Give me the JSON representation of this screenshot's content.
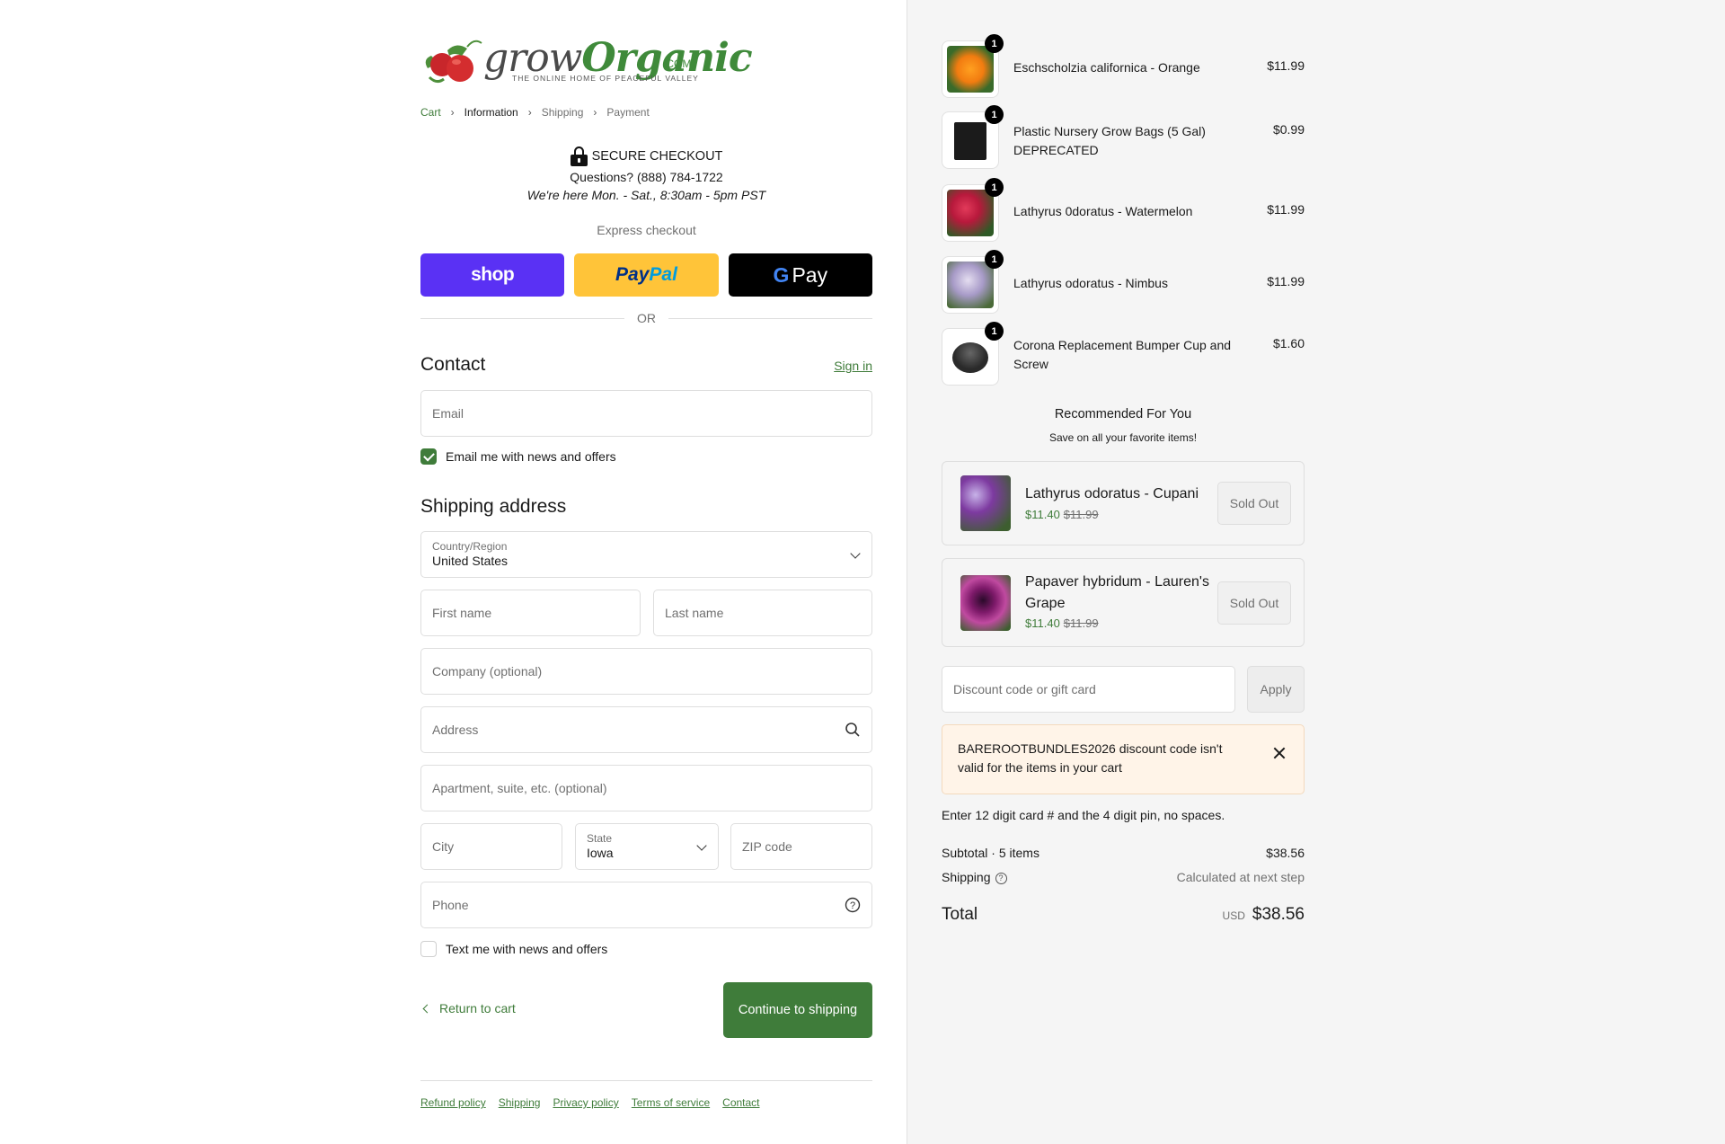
{
  "brand": {
    "grow": "grow",
    "organic": "Organic",
    "com": ".COM",
    "tagline": "THE ONLINE HOME OF PEACEFUL VALLEY"
  },
  "breadcrumb": [
    {
      "label": "Cart"
    },
    {
      "label": "Information"
    },
    {
      "label": "Shipping"
    },
    {
      "label": "Payment"
    }
  ],
  "secure": {
    "title": "SECURE CHECKOUT",
    "phone": "Questions? (888) 784-1722",
    "hours": "We're here Mon. - Sat., 8:30am - 5pm PST"
  },
  "express": {
    "label": "Express checkout",
    "shop": "shop",
    "paypal_a": "Pay",
    "paypal_b": "Pal",
    "gpay_g": "G",
    "gpay_text": "Pay"
  },
  "or_label": "OR",
  "contact": {
    "heading": "Contact",
    "sign_in": "Sign in",
    "email_placeholder": "Email",
    "news_label": "Email me with news and offers"
  },
  "shipping": {
    "heading": "Shipping address",
    "country_label": "Country/Region",
    "country_value": "United States",
    "first_name": "First name",
    "last_name": "Last name",
    "company": "Company (optional)",
    "address": "Address",
    "apartment": "Apartment, suite, etc. (optional)",
    "city": "City",
    "state_label": "State",
    "state_value": "Iowa",
    "zip": "ZIP code",
    "phone": "Phone",
    "text_label": "Text me with news and offers"
  },
  "actions": {
    "return": "Return to cart",
    "continue": "Continue to shipping"
  },
  "footer": [
    "Refund policy",
    "Shipping",
    "Privacy policy",
    "Terms of service",
    "Contact"
  ],
  "cart_items": [
    {
      "name": "Eschscholzia californica - Orange",
      "price": "$11.99",
      "qty": "1"
    },
    {
      "name": "Plastic Nursery Grow Bags (5 Gal) DEPRECATED",
      "price": "$0.99",
      "qty": "1"
    },
    {
      "name": "Lathyrus 0doratus - Watermelon",
      "price": "$11.99",
      "qty": "1"
    },
    {
      "name": "Lathyrus odoratus - Nimbus",
      "price": "$11.99",
      "qty": "1"
    },
    {
      "name": "Corona Replacement Bumper Cup and Screw",
      "price": "$1.60",
      "qty": "1"
    }
  ],
  "recommended": {
    "title": "Recommended For You",
    "subtitle": "Save on all your favorite items!",
    "items": [
      {
        "name": "Lathyrus odoratus - Cupani",
        "price": "$11.40",
        "was": "$11.99",
        "button": "Sold Out"
      },
      {
        "name": "Papaver hybridum - Lauren's Grape",
        "price": "$11.40",
        "was": "$11.99",
        "button": "Sold Out"
      }
    ]
  },
  "discount": {
    "placeholder": "Discount code or gift card",
    "apply": "Apply",
    "error": "BAREROOTBUNDLES2026 discount code isn't valid for the items in your cart",
    "hint": "Enter 12 digit card # and the 4 digit pin, no spaces."
  },
  "summary": {
    "subtotal_label": "Subtotal · 5 items",
    "subtotal_value": "$38.56",
    "shipping_label": "Shipping",
    "shipping_value": "Calculated at next step",
    "total_label": "Total",
    "currency": "USD",
    "total_value": "$38.56"
  },
  "colors": {
    "accent": "#3f7c3a",
    "shop": "#5a31f4",
    "paypal": "#ffc439",
    "gpay": "#000000",
    "notice_bg": "#fff4e8"
  }
}
